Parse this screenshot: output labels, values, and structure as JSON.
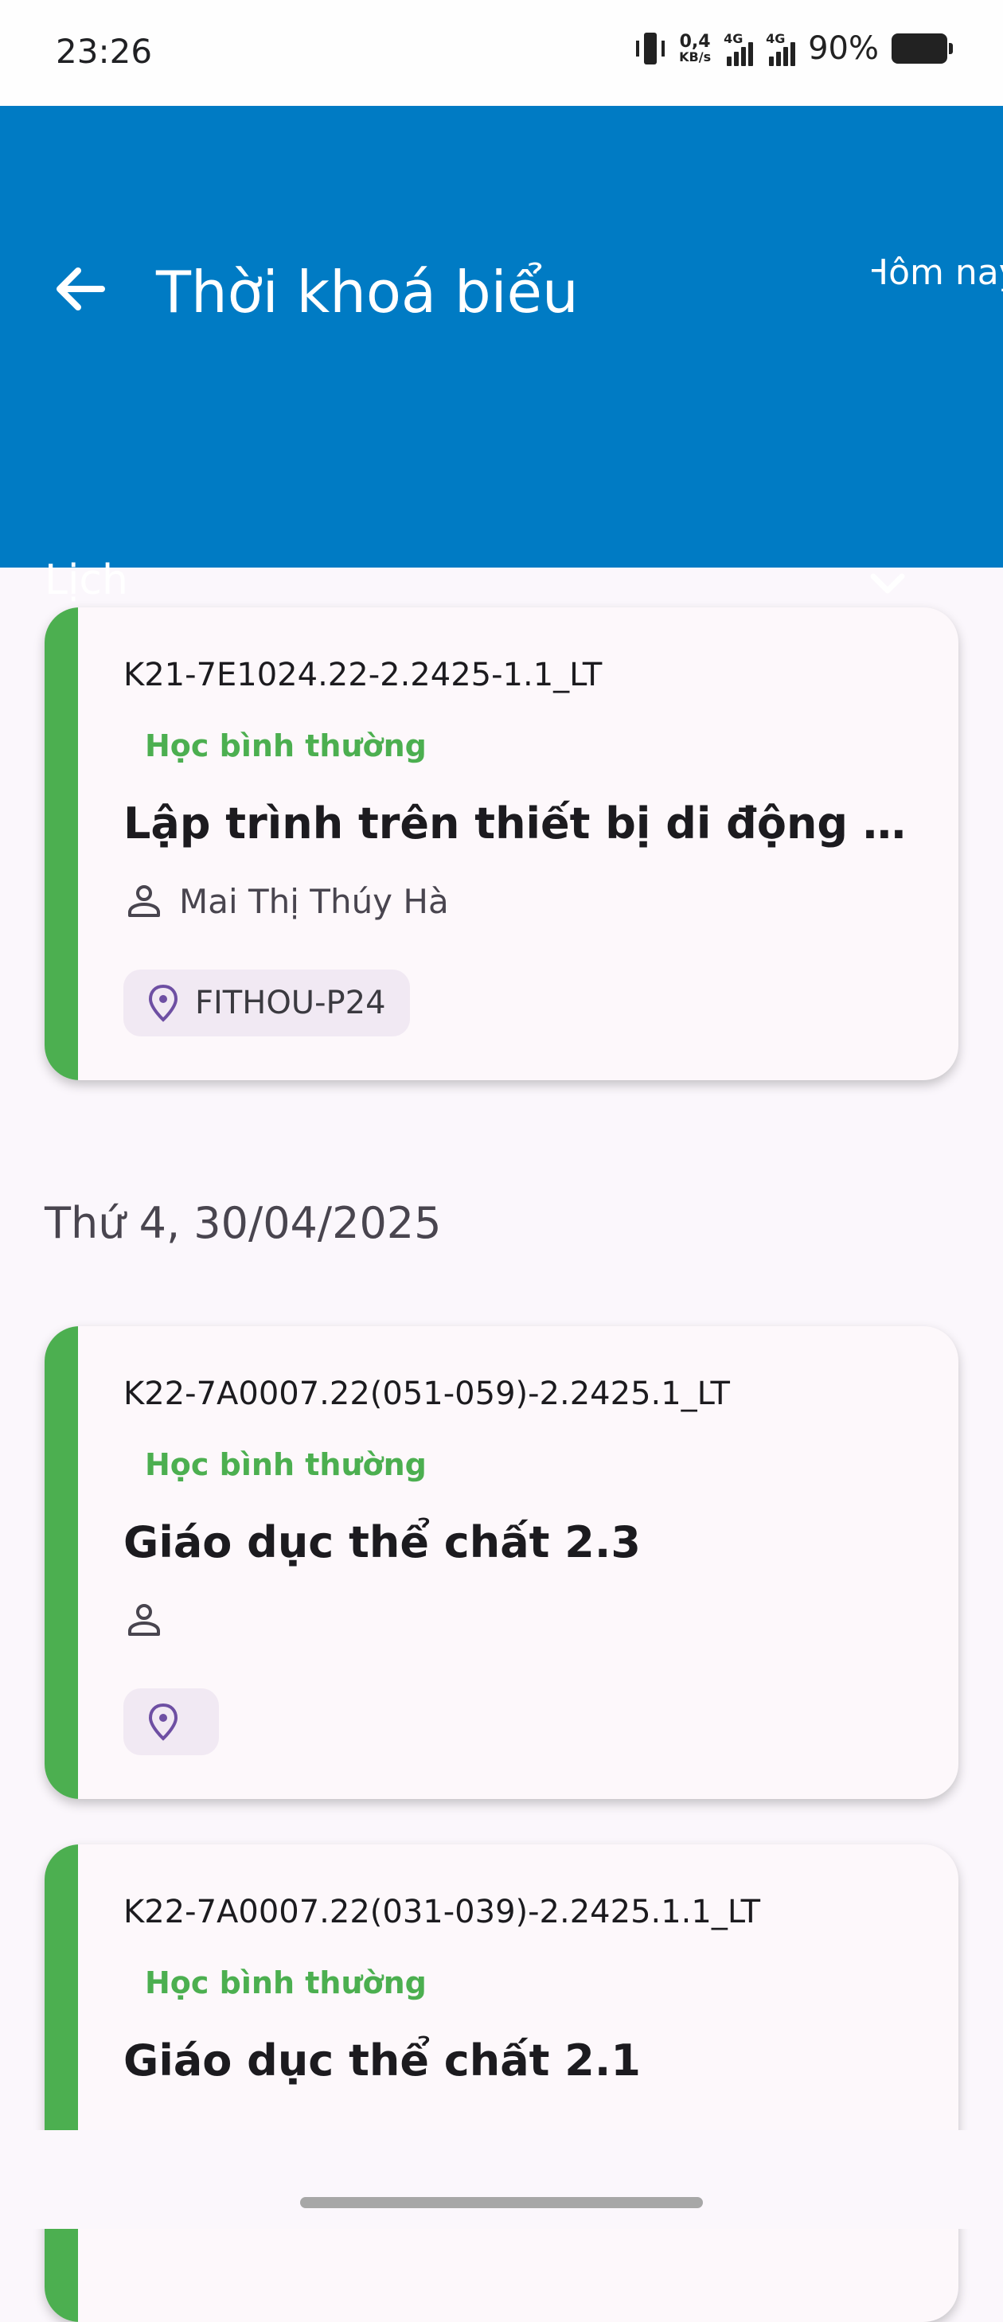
{
  "status_bar": {
    "time": "23:26",
    "speed_value": "0,4",
    "speed_unit": "KB/s",
    "network1": "4G",
    "network2": "4G",
    "battery_pct": "90%"
  },
  "app_bar": {
    "title": "Thời khoá biểu",
    "today_button": "Hôm nay",
    "calendar_label": "Lịch",
    "background_color": "#007bc4"
  },
  "sections": [
    {
      "date": "",
      "items": [
        {
          "code": "K21-7E1024.22-2.2425-1.1_LT",
          "status": "Học bình thường",
          "title": "Lập trình trên thiết bị di động nâng cao",
          "teacher": "Mai Thị Thúy Hà",
          "room": "FITHOU-P24"
        }
      ]
    },
    {
      "date": "Thứ 4, 30/04/2025",
      "items": [
        {
          "code": "K22-7A0007.22(051-059)-2.2425.1_LT",
          "status": "Học bình thường",
          "title": "Giáo dục thể chất 2.3",
          "teacher": "",
          "room": ""
        },
        {
          "code": "K22-7A0007.22(031-039)-2.2425.1.1_LT",
          "status": "Học bình thường",
          "title": "Giáo dục thể chất 2.1",
          "teacher": "",
          "room": ""
        }
      ]
    }
  ],
  "colors": {
    "accent_green": "#4caf50",
    "status_green": "#4caf50",
    "chip_background": "#f1e9f3",
    "location_icon": "#6e4fa3"
  },
  "icons": [
    "back-arrow-icon",
    "chevron-down-icon",
    "person-icon",
    "location-pin-icon"
  ]
}
